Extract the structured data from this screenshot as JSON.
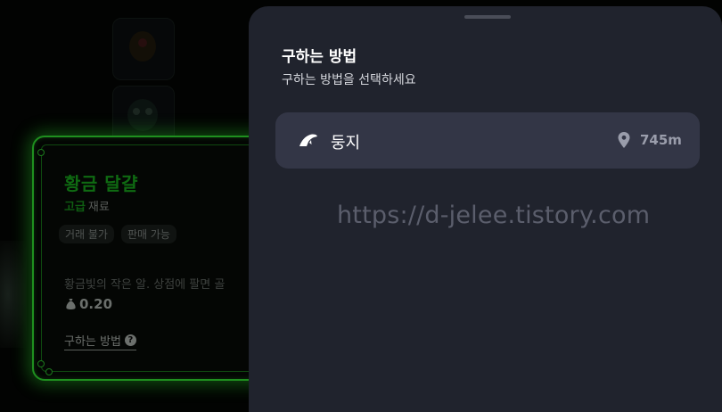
{
  "item": {
    "name": "황금 달걀",
    "grade": "고급",
    "material": "재료",
    "tags": [
      "거래 불가",
      "판매 가능"
    ],
    "description": "황금빛의 작은 알. 상점에 팔면 골",
    "price": "0.20",
    "how_to_get_link": "구하는 방법",
    "colors": {
      "glow": "#1f8f1f",
      "name": "#0f6a12"
    }
  },
  "sheet": {
    "title": "구하는 방법",
    "subtitle": "구하는 방법을 선택하세요",
    "methods": [
      {
        "icon": "nest-icon",
        "label": "둥지",
        "distance_icon": "location-pin-icon",
        "distance": "745m"
      }
    ],
    "watermark": "https://d-jelee.tistory.com",
    "colors": {
      "panel": "#20232d",
      "row": "#333646"
    }
  }
}
